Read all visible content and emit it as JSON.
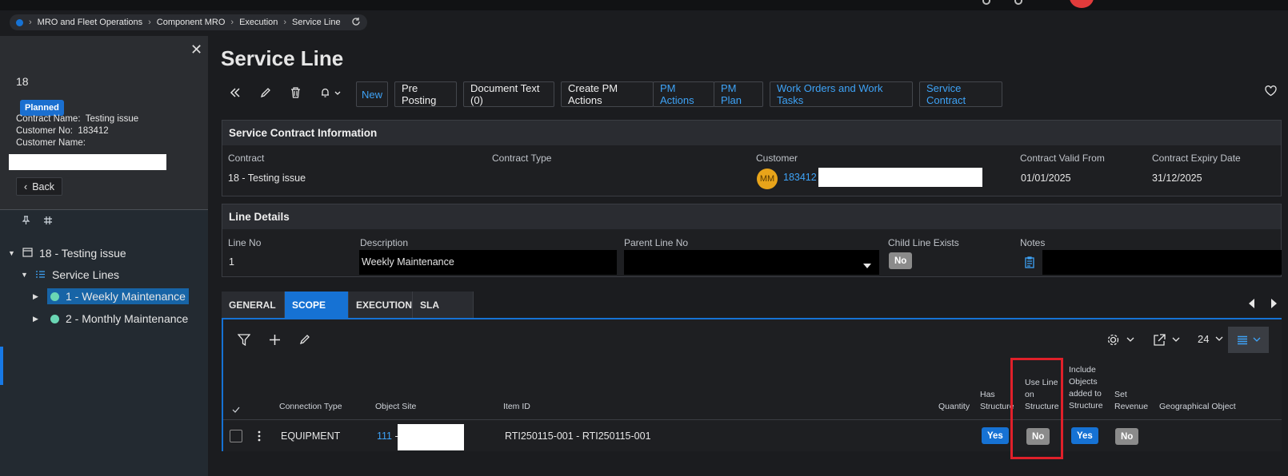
{
  "breadcrumb": [
    "MRO and Fleet Operations",
    "Component MRO",
    "Execution",
    "Service Line"
  ],
  "left_panel": {
    "record_no": "18",
    "status": "Planned",
    "contract_name_label": "Contract Name:",
    "contract_name": "Testing issue",
    "customer_no_label": "Customer No:",
    "customer_no": "183412",
    "customer_name_label": "Customer Name:",
    "back_label": "Back",
    "tree": {
      "root": "18 - Testing issue",
      "group": "Service Lines",
      "items": [
        "1 - Weekly Maintenance",
        "2 - Monthly Maintenance"
      ]
    }
  },
  "page_title": "Service Line",
  "toolbar": {
    "new": "New",
    "pre_posting": "Pre Posting",
    "document_text": "Document Text (0)",
    "create_pm_actions": "Create PM Actions",
    "pm_actions": "PM Actions",
    "pm_plan": "PM Plan",
    "work_orders": "Work Orders and Work Tasks",
    "service_contract": "Service Contract"
  },
  "contract_info": {
    "title": "Service Contract Information",
    "contract_label": "Contract",
    "contract_value": "18 - Testing issue",
    "contract_type_label": "Contract Type",
    "customer_label": "Customer",
    "customer_initials": "MM",
    "customer_no": "183412",
    "valid_from_label": "Contract Valid From",
    "valid_from": "01/01/2025",
    "expiry_label": "Contract Expiry Date",
    "expiry": "31/12/2025"
  },
  "line_details": {
    "title": "Line Details",
    "line_no_label": "Line No",
    "line_no": "1",
    "description_label": "Description",
    "description": "Weekly Maintenance",
    "parent_line_label": "Parent Line No",
    "child_line_label": "Child Line Exists",
    "child_line_value": "No",
    "notes_label": "Notes"
  },
  "tabs": [
    "GENERAL",
    "SCOPE",
    "EXECUTION",
    "SLA"
  ],
  "grid": {
    "page_size": "24",
    "columns": {
      "connection_type": "Connection Type",
      "object_site": "Object Site",
      "item_id": "Item ID",
      "quantity": "Quantity",
      "has_structure_1": "Has",
      "has_structure_2": "Structure",
      "use_line_1": "Use Line",
      "use_line_2": "on",
      "use_line_3": "Structure",
      "include_1": "Include",
      "include_2": "Objects",
      "include_3": "added to",
      "include_4": "Structure",
      "set_revenue_1": "Set",
      "set_revenue_2": "Revenue",
      "geo_object": "Geographical Object"
    },
    "rows": [
      {
        "connection_type": "EQUIPMENT",
        "object_site": "111",
        "object_site_suffix": " -",
        "item_id": "RTI250115-001 - RTI250115-001",
        "has_structure": "Yes",
        "use_line_on_structure": "No",
        "include_objects": "Yes",
        "set_revenue": "No"
      }
    ]
  }
}
